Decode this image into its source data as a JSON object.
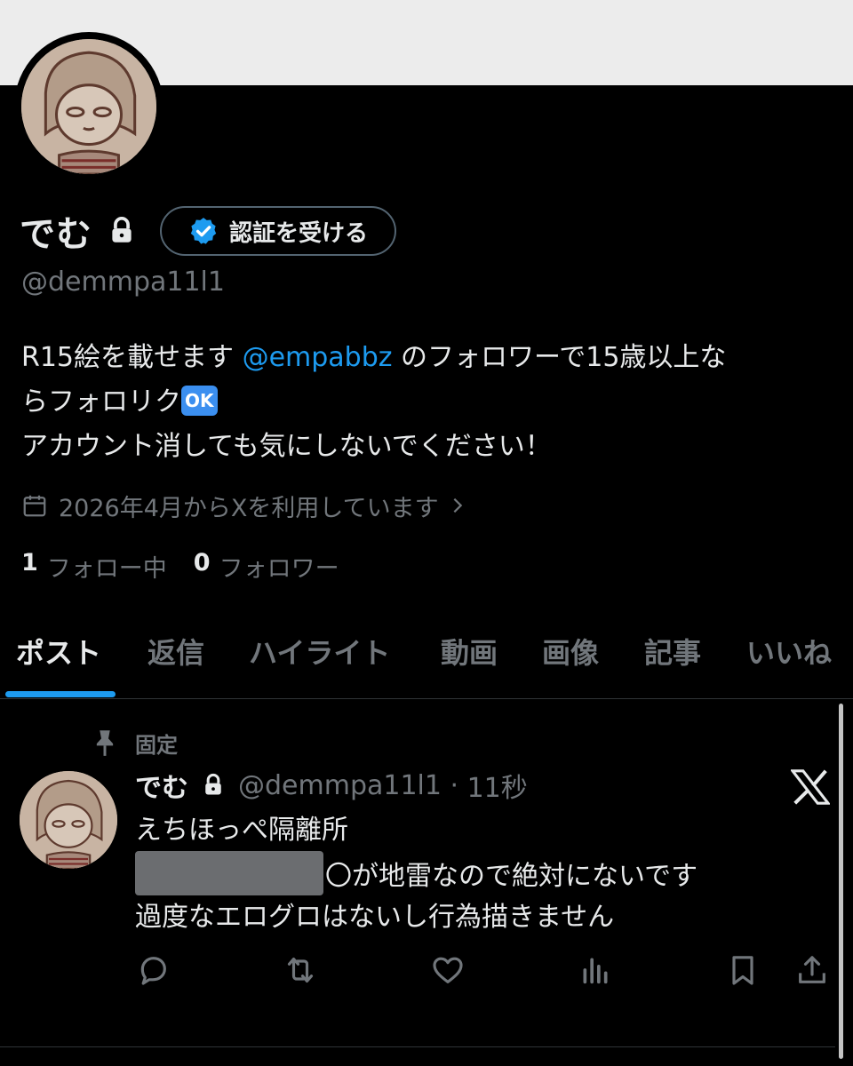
{
  "profile": {
    "display_name": "でむ",
    "verify_button": "認証を受ける",
    "handle": "@demmpa11l1",
    "bio_part1": "R15絵を載せます ",
    "bio_mention": "@empabbz",
    "bio_part2": " のフォロワーで15歳以上な",
    "bio_line2": "らフォロリク",
    "ok_emoji": "OK",
    "bio_line3": "アカウント消しても気にしないでください！",
    "joined": "2026年4月からXを利用しています",
    "following_count": "1",
    "following_label": "フォロー中",
    "followers_count": "0",
    "followers_label": "フォロワー"
  },
  "tabs": [
    {
      "label": "ポスト",
      "active": true
    },
    {
      "label": "返信"
    },
    {
      "label": "ハイライト"
    },
    {
      "label": "動画"
    },
    {
      "label": "画像"
    },
    {
      "label": "記事"
    },
    {
      "label": "いいね"
    }
  ],
  "post": {
    "pinned_label": "固定",
    "name": "でむ",
    "handle": "@demmpa11l1",
    "time": "11秒",
    "line1": "えちほっぺ隔離所",
    "line2_rest": "〇が地雷なので絶対にないです",
    "line3": "過度なエログロはないし行為描きません"
  },
  "colors": {
    "accent": "#1d9bf0",
    "text": "#e7e9ea",
    "muted": "#71767b",
    "background": "#000000"
  },
  "icons": [
    "lock-icon",
    "verified-badge-icon",
    "calendar-icon",
    "chevron-right-icon",
    "pin-icon",
    "x-logo-icon",
    "reply-icon",
    "repost-icon",
    "like-icon",
    "views-icon",
    "bookmark-icon",
    "share-icon"
  ]
}
